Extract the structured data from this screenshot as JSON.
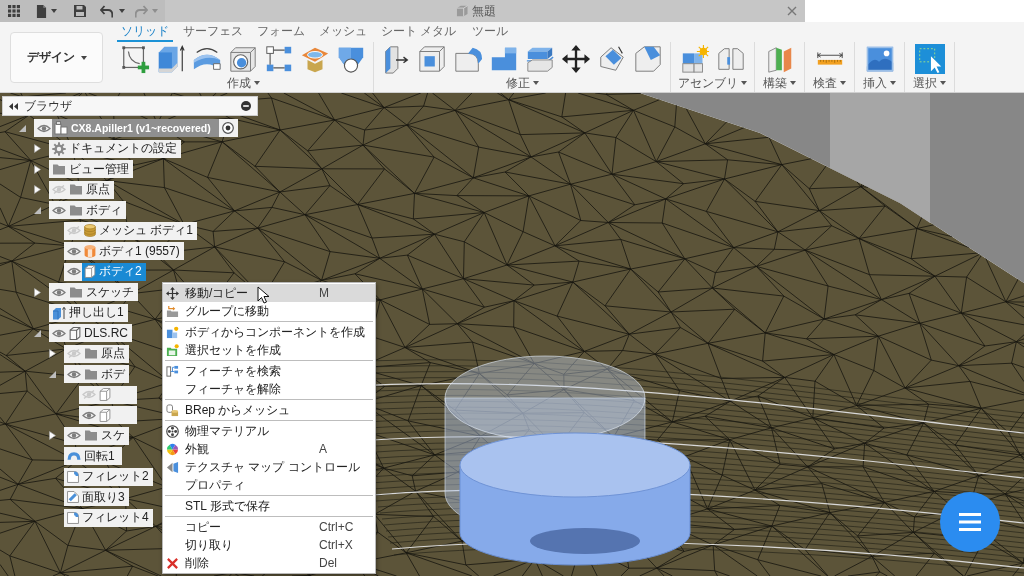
{
  "window": {
    "title": "無題"
  },
  "quick_access": {
    "undo": {
      "disabled": false
    },
    "redo": {
      "disabled": true
    }
  },
  "workspace": {
    "label": "デザイン"
  },
  "tabs": [
    {
      "label": "ソリッド",
      "selected": true
    },
    {
      "label": "サーフェス",
      "selected": false
    },
    {
      "label": "フォーム",
      "selected": false
    },
    {
      "label": "メッシュ",
      "selected": false
    },
    {
      "label": "シート メタル",
      "selected": false
    },
    {
      "label": "ツール",
      "selected": false
    }
  ],
  "tool_groups": [
    {
      "label": "作成"
    },
    {
      "label": "修正"
    },
    {
      "label": "アセンブリ"
    },
    {
      "label": "構築"
    },
    {
      "label": "検査"
    },
    {
      "label": "挿入"
    },
    {
      "label": "選択"
    }
  ],
  "browser": {
    "title": "ブラウザ",
    "root": {
      "label": "CX8.Apiller1 (v1~recovered)",
      "kind": "component",
      "visible": true,
      "expanded": true,
      "active": true,
      "selected": false,
      "children": [
        {
          "label": "ドキュメントの設定",
          "kind": "settings",
          "expanded": false,
          "selected": false
        },
        {
          "label": "ビュー管理",
          "kind": "folder",
          "expanded": false,
          "selected": false
        },
        {
          "label": "原点",
          "kind": "folder",
          "visible": false,
          "expanded": false,
          "selected": false
        },
        {
          "label": "ボディ",
          "kind": "folder",
          "visible": true,
          "expanded": true,
          "selected": false,
          "children": [
            {
              "label": "メッシュ ボディ1",
              "kind": "mesh-body",
              "visible": false,
              "selected": false
            },
            {
              "label": "ボディ1 (9557)",
              "kind": "tube-body",
              "visible": true,
              "selected": false
            },
            {
              "label": "ボディ2",
              "kind": "body",
              "visible": true,
              "selected": true
            }
          ]
        },
        {
          "label": "スケッチ",
          "kind": "folder",
          "visible": true,
          "expanded": false,
          "selected": false
        },
        {
          "label": "押し出し1",
          "kind": "extrude",
          "selected": false
        },
        {
          "label": "DLS.RC",
          "kind": "component-box",
          "visible": true,
          "expanded": true,
          "selected": false,
          "children": [
            {
              "label": "原点",
              "kind": "folder",
              "visible": false,
              "expanded": false,
              "selected": false
            },
            {
              "label": "ボデ",
              "kind": "folder",
              "visible": true,
              "expanded": true,
              "selected": false,
              "children": [
                {
                  "kind": "body",
                  "visible": false,
                  "selected": false
                },
                {
                  "kind": "body",
                  "visible": true,
                  "selected": false
                }
              ]
            },
            {
              "label": "スケ",
              "kind": "folder",
              "visible": true,
              "expanded": false,
              "selected": false
            },
            {
              "label": "回転1",
              "kind": "revolve",
              "selected": false
            },
            {
              "label": "フィレット2",
              "kind": "fillet",
              "selected": false
            },
            {
              "label": "面取り3",
              "kind": "chamfer",
              "selected": false
            },
            {
              "label": "フィレット4",
              "kind": "fillet",
              "selected": false
            }
          ]
        }
      ]
    }
  },
  "context_menu": {
    "sections": [
      {
        "items": [
          {
            "label": "移動/コピー",
            "shortcut": "M",
            "kind": "move",
            "highlighted": true
          },
          {
            "label": "グループに移動",
            "kind": "group",
            "highlighted": false
          }
        ]
      },
      {
        "items": [
          {
            "label": "ボディからコンポーネントを作成",
            "kind": "component",
            "highlighted": false
          },
          {
            "label": "選択セットを作成",
            "kind": "selection-set",
            "highlighted": false
          }
        ]
      },
      {
        "items": [
          {
            "label": "フィーチャを検索",
            "kind": "find",
            "highlighted": false
          },
          {
            "label": "フィーチャを解除",
            "kind": "plain",
            "highlighted": false
          }
        ]
      },
      {
        "items": [
          {
            "label": "BRep からメッシュ",
            "kind": "mesh",
            "highlighted": false
          }
        ]
      },
      {
        "items": [
          {
            "label": "物理マテリアル",
            "kind": "material",
            "highlighted": false
          },
          {
            "label": "外観",
            "shortcut": "A",
            "kind": "appearance",
            "highlighted": false
          },
          {
            "label": "テクスチャ マップ コントロール",
            "kind": "texture",
            "highlighted": false
          },
          {
            "label": "プロパティ",
            "kind": "plain",
            "highlighted": false
          }
        ]
      },
      {
        "items": [
          {
            "label": "STL 形式で保存",
            "kind": "plain",
            "highlighted": false
          }
        ]
      },
      {
        "items": [
          {
            "label": "コピー",
            "shortcut": "Ctrl+C",
            "kind": "plain",
            "highlighted": false
          },
          {
            "label": "切り取り",
            "shortcut": "Ctrl+X",
            "kind": "plain",
            "highlighted": false
          },
          {
            "label": "削除",
            "shortcut": "Del",
            "kind": "delete",
            "highlighted": false
          }
        ]
      }
    ]
  }
}
